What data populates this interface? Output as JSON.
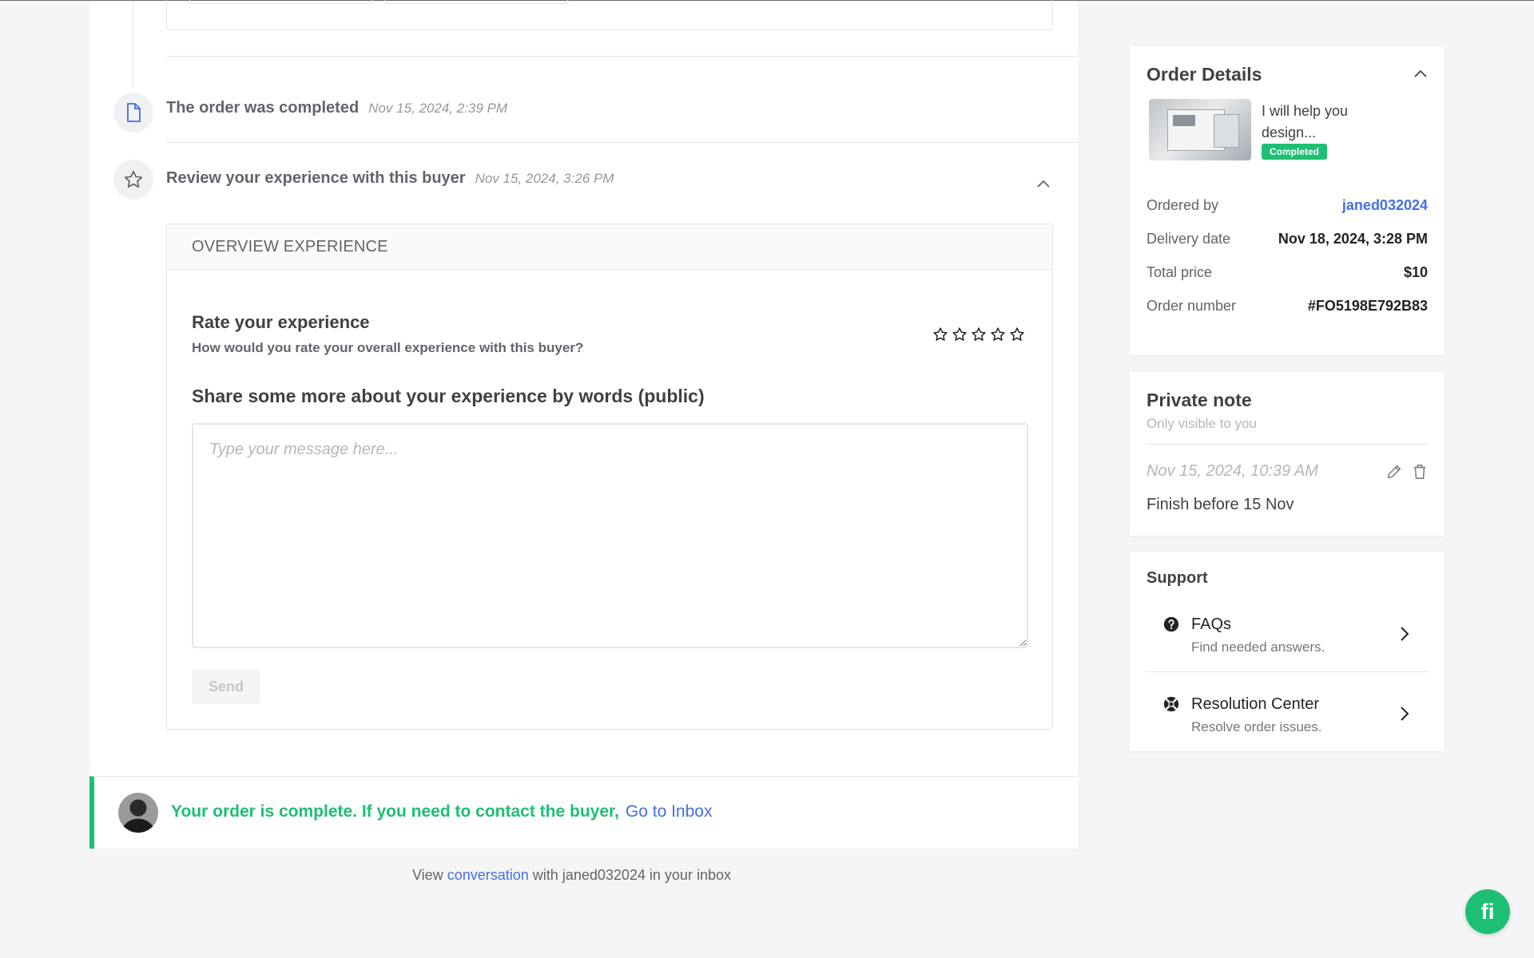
{
  "timeline": {
    "completed": {
      "title": "The order was completed",
      "date": "Nov 15, 2024, 2:39 PM"
    },
    "review": {
      "title": "Review your experience with this buyer",
      "date": "Nov 15, 2024, 3:26 PM"
    }
  },
  "review_card": {
    "header": "OVERVIEW EXPERIENCE",
    "rate_title": "Rate your experience",
    "rate_subtitle": "How would you rate your overall experience with this buyer?",
    "rating": 0,
    "max_rating": 5,
    "share_title": "Share some more about your experience by words (public)",
    "message_placeholder": "Type your message here...",
    "message_value": "",
    "send_label": "Send"
  },
  "banner": {
    "text": "Your order is complete. If you need to contact the buyer,",
    "link": "Go to Inbox"
  },
  "view_conversation": {
    "prefix": "View",
    "link": "conversation",
    "suffix": "with janed032024 in your inbox"
  },
  "order_details": {
    "title": "Order Details",
    "gig_title": "I will help you design...",
    "status": "Completed",
    "rows": [
      {
        "label": "Ordered by",
        "value": "janed032024"
      },
      {
        "label": "Delivery date",
        "value": "Nov 18, 2024, 3:28 PM"
      },
      {
        "label": "Total price",
        "value": "$10"
      },
      {
        "label": "Order number",
        "value": "#FO5198E792B83"
      }
    ]
  },
  "private_note": {
    "title": "Private note",
    "subtitle": "Only visible to you",
    "date": "Nov 15, 2024, 10:39 AM",
    "text": "Finish before 15 Nov"
  },
  "support": {
    "title": "Support",
    "items": [
      {
        "name": "FAQs",
        "desc": "Find needed answers.",
        "icon": "question-circle-icon"
      },
      {
        "name": "Resolution Center",
        "desc": "Resolve order issues.",
        "icon": "lifebuoy-icon"
      }
    ]
  },
  "fab": {
    "label": "fi"
  },
  "colors": {
    "brand_green": "#1dbf73",
    "link_blue": "#446ee7",
    "text_dark": "#404145",
    "text_muted": "#62646a"
  }
}
